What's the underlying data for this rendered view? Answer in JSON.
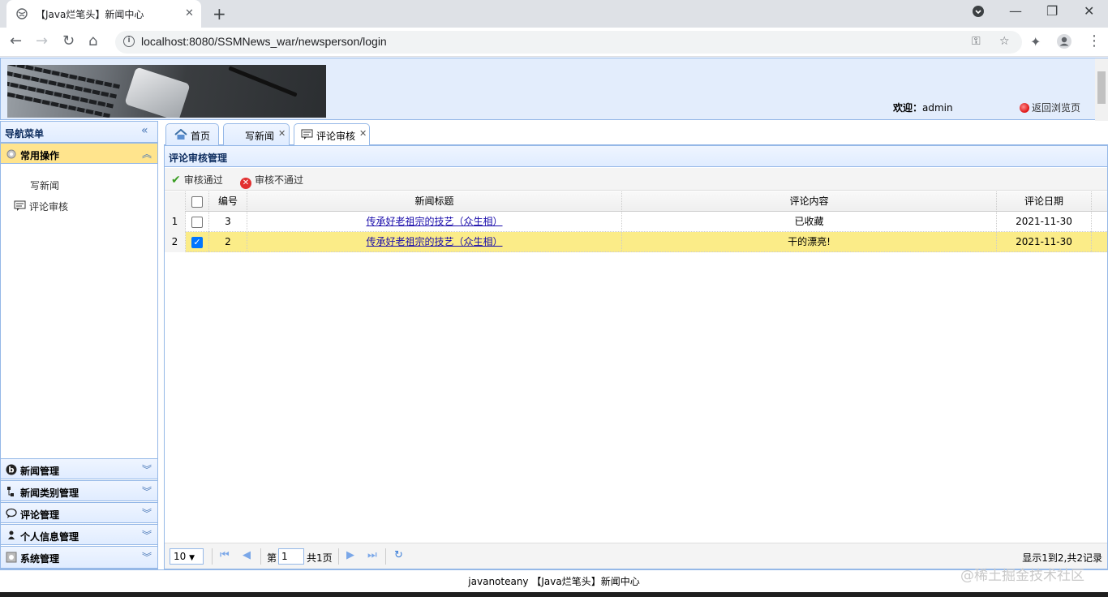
{
  "browser": {
    "tab_title": "【Java烂笔头】新闻中心",
    "url": "localhost:8080/SSMNews_war/newsperson/login"
  },
  "header": {
    "welcome_label": "欢迎：",
    "username": "admin",
    "back_link": "返回浏览页"
  },
  "west": {
    "title": "导航菜单",
    "active_group": "常用操作",
    "active_items": [
      "写新闻",
      "评论审核"
    ],
    "groups": [
      "新闻管理",
      "新闻类别管理",
      "评论管理",
      "个人信息管理",
      "系统管理"
    ]
  },
  "tabs": [
    {
      "label": "首页",
      "icon": "home-icon"
    },
    {
      "label": "写新闻",
      "icon": ""
    },
    {
      "label": "评论审核",
      "icon": "comment-icon"
    }
  ],
  "panel": {
    "title": "评论审核管理",
    "toolbar": {
      "approve": "审核通过",
      "reject": "审核不通过"
    }
  },
  "grid": {
    "columns": [
      "编号",
      "新闻标题",
      "评论内容",
      "评论日期"
    ],
    "rows": [
      {
        "num": "1",
        "id": "3",
        "title": "传承好老祖宗的技艺（众生相）",
        "content": "已收藏",
        "date": "2021-11-30",
        "checked": false
      },
      {
        "num": "2",
        "id": "2",
        "title": "传承好老祖宗的技艺（众生相）",
        "content": "干的漂亮!",
        "date": "2021-11-30",
        "checked": true
      }
    ]
  },
  "pager": {
    "page_size": "10",
    "page_prefix": "第",
    "page_value": "1",
    "page_total": "共1页",
    "info": "显示1到2,共2记录"
  },
  "footer": "javanoteany 【Java烂笔头】新闻中心",
  "watermark": "@稀土掘金技术社区"
}
